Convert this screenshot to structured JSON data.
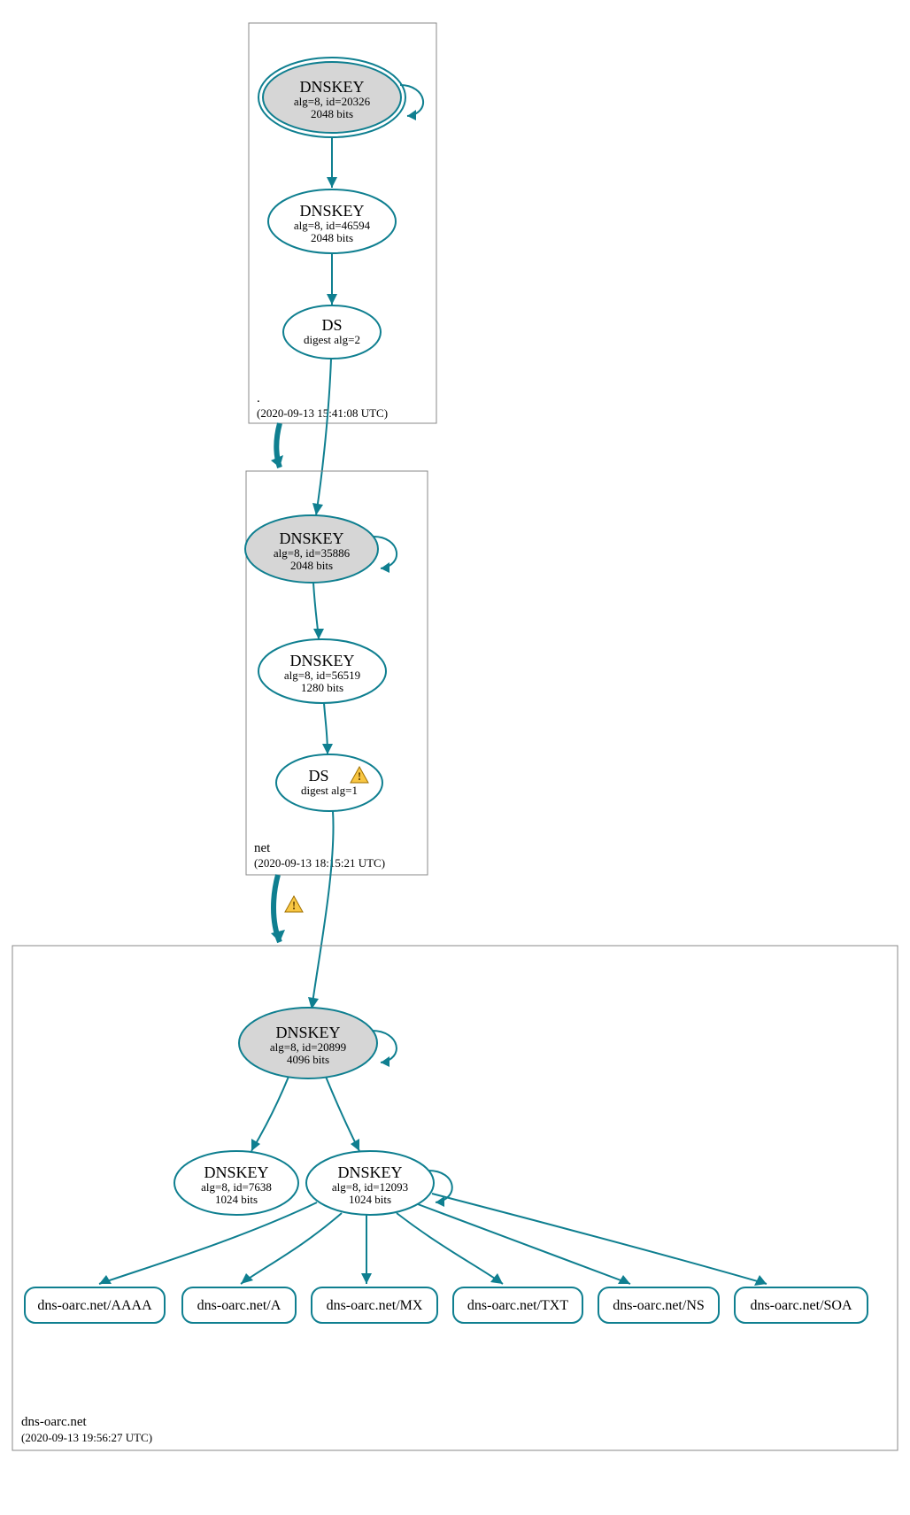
{
  "chart_data": {
    "type": "dnssec-delegation-graph",
    "zones": [
      {
        "name": ".",
        "timestamp": "(2020-09-13 15:41:08 UTC)",
        "nodes": [
          {
            "id": "root_ksk",
            "type": "DNSKEY",
            "title": "DNSKEY",
            "detail1": "alg=8, id=20326",
            "detail2": "2048 bits",
            "style": "ksk-double",
            "self_loop": true
          },
          {
            "id": "root_zsk",
            "type": "DNSKEY",
            "title": "DNSKEY",
            "detail1": "alg=8, id=46594",
            "detail2": "2048 bits",
            "style": "plain",
            "self_loop": false
          },
          {
            "id": "root_ds",
            "type": "DS",
            "title": "DS",
            "detail1": "digest alg=2",
            "detail2": "",
            "style": "plain",
            "self_loop": false
          }
        ],
        "edges": [
          {
            "from": "root_ksk",
            "to": "root_zsk"
          },
          {
            "from": "root_zsk",
            "to": "root_ds"
          }
        ]
      },
      {
        "name": "net",
        "timestamp": "(2020-09-13 18:15:21 UTC)",
        "nodes": [
          {
            "id": "net_ksk",
            "type": "DNSKEY",
            "title": "DNSKEY",
            "detail1": "alg=8, id=35886",
            "detail2": "2048 bits",
            "style": "ksk-filled",
            "self_loop": true
          },
          {
            "id": "net_zsk",
            "type": "DNSKEY",
            "title": "DNSKEY",
            "detail1": "alg=8, id=56519",
            "detail2": "1280 bits",
            "style": "plain",
            "self_loop": false
          },
          {
            "id": "net_ds",
            "type": "DS",
            "title": "DS",
            "detail1": "digest alg=1",
            "detail2": "",
            "style": "plain",
            "self_loop": false,
            "warning": true
          }
        ],
        "edges": [
          {
            "from": "net_ksk",
            "to": "net_zsk"
          },
          {
            "from": "net_zsk",
            "to": "net_ds"
          }
        ]
      },
      {
        "name": "dns-oarc.net",
        "timestamp": "(2020-09-13 19:56:27 UTC)",
        "nodes": [
          {
            "id": "oarc_ksk",
            "type": "DNSKEY",
            "title": "DNSKEY",
            "detail1": "alg=8, id=20899",
            "detail2": "4096 bits",
            "style": "ksk-filled",
            "self_loop": true
          },
          {
            "id": "oarc_zsk1",
            "type": "DNSKEY",
            "title": "DNSKEY",
            "detail1": "alg=8, id=7638",
            "detail2": "1024 bits",
            "style": "plain",
            "self_loop": false
          },
          {
            "id": "oarc_zsk2",
            "type": "DNSKEY",
            "title": "DNSKEY",
            "detail1": "alg=8, id=12093",
            "detail2": "1024 bits",
            "style": "plain",
            "self_loop": true
          }
        ],
        "edges": [
          {
            "from": "oarc_ksk",
            "to": "oarc_zsk1"
          },
          {
            "from": "oarc_ksk",
            "to": "oarc_zsk2"
          }
        ],
        "rrsets": [
          "dns-oarc.net/AAAA",
          "dns-oarc.net/A",
          "dns-oarc.net/MX",
          "dns-oarc.net/TXT",
          "dns-oarc.net/NS",
          "dns-oarc.net/SOA"
        ]
      }
    ],
    "cross_zone_edges": [
      {
        "from": "root_ds",
        "to": "net_ksk",
        "style": "both",
        "warning": false
      },
      {
        "from": "net_ds",
        "to": "oarc_ksk",
        "style": "both",
        "warning": true
      }
    ]
  },
  "zones": {
    "root": {
      "label": ".",
      "time": "(2020-09-13 15:41:08 UTC)"
    },
    "net": {
      "label": "net",
      "time": "(2020-09-13 18:15:21 UTC)"
    },
    "oarc": {
      "label": "dns-oarc.net",
      "time": "(2020-09-13 19:56:27 UTC)"
    }
  },
  "nodes": {
    "root_ksk": {
      "title": "DNSKEY",
      "l1": "alg=8, id=20326",
      "l2": "2048 bits"
    },
    "root_zsk": {
      "title": "DNSKEY",
      "l1": "alg=8, id=46594",
      "l2": "2048 bits"
    },
    "root_ds": {
      "title": "DS",
      "l1": "digest alg=2"
    },
    "net_ksk": {
      "title": "DNSKEY",
      "l1": "alg=8, id=35886",
      "l2": "2048 bits"
    },
    "net_zsk": {
      "title": "DNSKEY",
      "l1": "alg=8, id=56519",
      "l2": "1280 bits"
    },
    "net_ds": {
      "title": "DS",
      "l1": "digest alg=1"
    },
    "oarc_ksk": {
      "title": "DNSKEY",
      "l1": "alg=8, id=20899",
      "l2": "4096 bits"
    },
    "oarc_zsk1": {
      "title": "DNSKEY",
      "l1": "alg=8, id=7638",
      "l2": "1024 bits"
    },
    "oarc_zsk2": {
      "title": "DNSKEY",
      "l1": "alg=8, id=12093",
      "l2": "1024 bits"
    }
  },
  "rrsets": {
    "aaaa": "dns-oarc.net/AAAA",
    "a": "dns-oarc.net/A",
    "mx": "dns-oarc.net/MX",
    "txt": "dns-oarc.net/TXT",
    "ns": "dns-oarc.net/NS",
    "soa": "dns-oarc.net/SOA"
  }
}
